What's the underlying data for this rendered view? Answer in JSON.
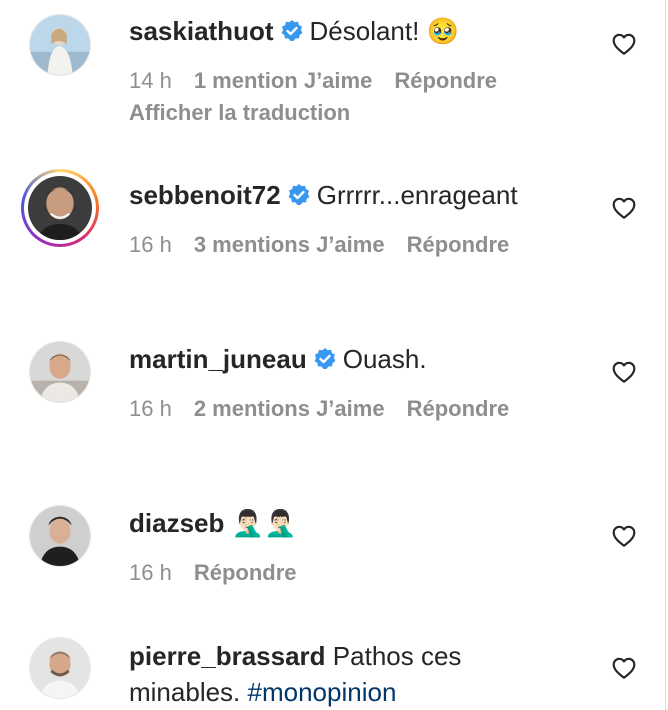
{
  "comments": [
    {
      "username": "saskiathuot",
      "verified": true,
      "text": "Désolant!",
      "emoji": "🥹",
      "time": "14 h",
      "likes": "1 mention J’aime",
      "reply": "Répondre",
      "translate": "Afficher la traduction",
      "avatar_icon": "profile-photo"
    },
    {
      "username": "sebbenoit72",
      "verified": true,
      "text": "Grrrrr...enrageant",
      "time": "16 h",
      "likes": "3 mentions J’aime",
      "reply": "Répondre",
      "avatar_icon": "profile-photo-story-ring"
    },
    {
      "username": "martin_juneau",
      "verified": true,
      "text": "Ouash.",
      "time": "16 h",
      "likes": "2 mentions J’aime",
      "reply": "Répondre",
      "avatar_icon": "profile-photo"
    },
    {
      "username": "diazseb",
      "verified": false,
      "emoji": "🤦🏻‍♂️🤦🏻‍♂️",
      "time": "16 h",
      "reply": "Répondre",
      "avatar_icon": "profile-photo"
    },
    {
      "username": "pierre_brassard",
      "verified": false,
      "text_line1": "Pathos ces",
      "text_line2": "minables.",
      "hashtag": "#monopinion",
      "avatar_icon": "profile-photo"
    }
  ],
  "colors": {
    "text": "#262626",
    "muted": "#8e8e8e",
    "verified": "#3897f0",
    "hashtag": "#00376b"
  },
  "icons": {
    "like": "heart-outline-icon",
    "verified": "verified-badge-icon"
  }
}
